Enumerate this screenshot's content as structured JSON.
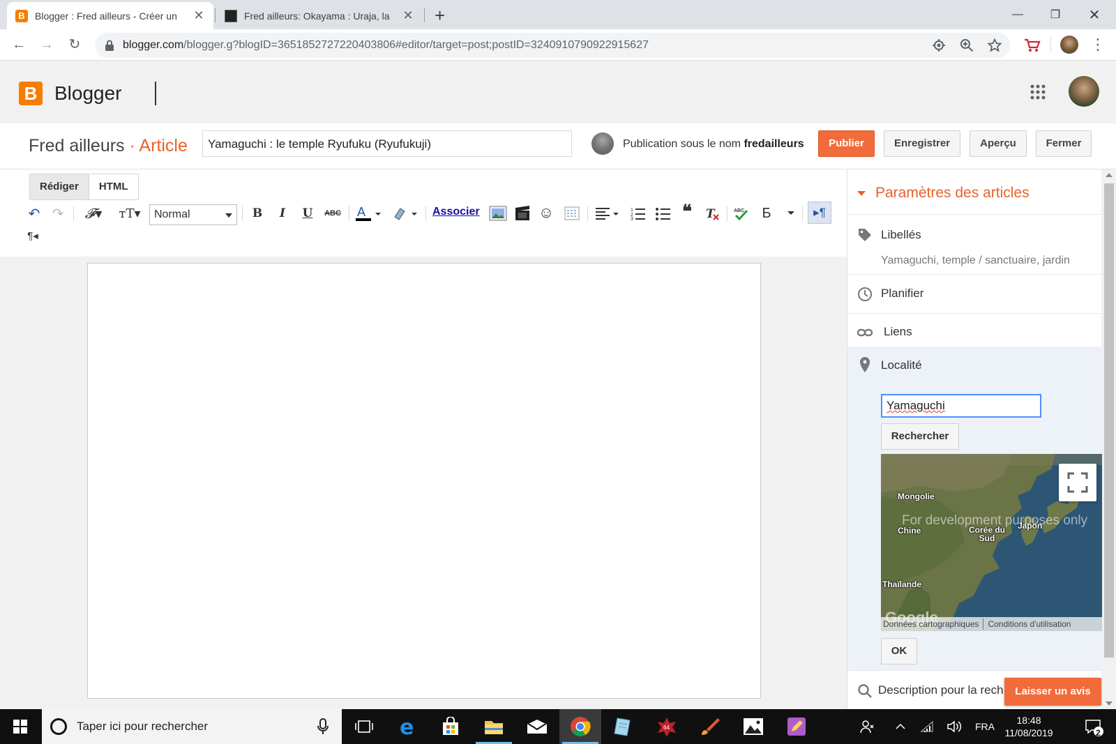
{
  "browser": {
    "tabs": [
      {
        "title": "Blogger : Fred ailleurs - Créer un",
        "active": true
      },
      {
        "title": "Fred ailleurs: Okayama : Uraja, la",
        "active": false
      }
    ],
    "url_host": "blogger.com",
    "url_rest": "/blogger.g?blogID=3651852727220403806#editor/target=post;postID=3240910790922915627"
  },
  "header": {
    "app_name": "Blogger",
    "logo_letter": "B"
  },
  "postbar": {
    "blog_name": "Fred ailleurs",
    "separator": " · ",
    "section": "Article",
    "post_title": "Yamaguchi : le temple Ryufuku (Ryufukuji)",
    "publish_as_prefix": "Publication sous le nom ",
    "publish_as_user": "fredailleurs",
    "buttons": {
      "publish": "Publier",
      "save": "Enregistrer",
      "preview": "Aperçu",
      "close": "Fermer"
    }
  },
  "editor": {
    "mode_tabs": [
      "Rédiger",
      "HTML"
    ],
    "font_size_value": "Normal",
    "link_label": "Associer",
    "bold": "B",
    "italic": "I",
    "underline": "U",
    "strike": "ABC",
    "cyrillic": "Б"
  },
  "sidebar": {
    "title": "Paramètres des articles",
    "labels": {
      "label": "Libellés",
      "value": "Yamaguchi, temple / sanctuaire, jardin"
    },
    "schedule": "Planifier",
    "links": "Liens",
    "location": {
      "label": "Localité",
      "input_value": "Yamaguchi",
      "search_button": "Rechercher",
      "ok_button": "OK",
      "map": {
        "watermark": "For development purposes only",
        "places": [
          "Mongolie",
          "Chine",
          "Corée du Sud",
          "Japon",
          "Thaïlande"
        ],
        "map_data": "Données cartographiques",
        "terms": "Conditions d'utilisation",
        "logo": "Google"
      }
    },
    "search_description": "Description pour la rech",
    "feedback": "Laisser un avis"
  },
  "taskbar": {
    "search_placeholder": "Taper ici pour rechercher",
    "language": "FRA",
    "time": "18:48",
    "date": "11/08/2019",
    "notification_count": "2"
  },
  "colors": {
    "blogger_orange": "#f57d00",
    "accent": "#e8622a",
    "button_orange": "#f26b3a"
  }
}
